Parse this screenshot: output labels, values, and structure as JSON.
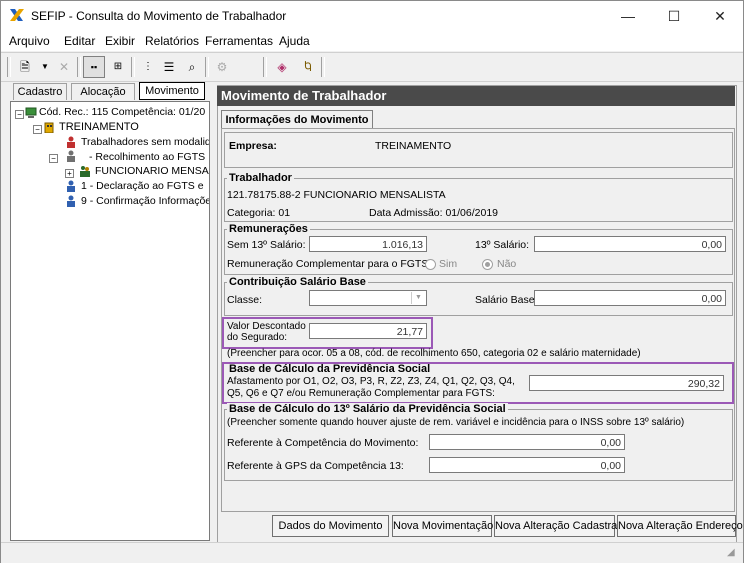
{
  "window": {
    "title": "SEFIP - Consulta do Movimento de Trabalhador",
    "minimize": "—",
    "maximize": "☐",
    "close": "✕"
  },
  "menu": [
    "Arquivo",
    "Editar",
    "Exibir",
    "Relatórios",
    "Ferramentas",
    "Ajuda"
  ],
  "tabs": {
    "cadastro": "Cadastro",
    "alocacao": "Alocação",
    "movimento": "Movimento"
  },
  "tree": {
    "root": "Cód. Rec.: 115 Competência: 01/20",
    "company": "TREINAMENTO",
    "items": [
      "Trabalhadores sem modalid",
      "- Recolhimento ao FGTS",
      "FUNCIONARIO MENSA",
      "1 - Declaração ao FGTS e",
      "9 - Confirmação Informaçõe"
    ]
  },
  "panel": {
    "header": "Movimento de Trabalhador",
    "tab": "Informações do Movimento",
    "empresa_label": "Empresa:",
    "empresa_value": "TREINAMENTO",
    "trabalhador_title": "Trabalhador",
    "trabalhador_line": "121.78175.88-2 FUNCIONARIO MENSALISTA",
    "categoria": "Categoria: 01",
    "admissao": "Data Admissão: 01/06/2019",
    "remuneracoes_title": "Remunerações",
    "sem13_label": "Sem 13º Salário:",
    "sem13_value": "1.016,13",
    "sal13_label": "13º Salário:",
    "sal13_value": "0,00",
    "rem_comp_label": "Remuneração Complementar para o FGTS:",
    "sim": "Sim",
    "nao": "Não",
    "contrib_title": "Contribuição Salário Base",
    "classe_label": "Classe:",
    "salbase_label": "Salário Base:",
    "salbase_value": "0,00",
    "valor_desc_label1": "Valor Descontado",
    "valor_desc_label2": "do Segurado:",
    "valor_desc_value": "21,77",
    "preencher_ocor": "(Preencher para ocor. 05 a 08, cód. de recolhimento 650, categoria 02 e salário maternidade)",
    "base_title": "Base de Cálculo da Previdência Social",
    "base_line1": "Afastamento por O1, O2, O3, P3, R, Z2, Z3, Z4, Q1, Q2, Q3, Q4,",
    "base_line2": "Q5, Q6 e Q7  e/ou Remuneração Complementar para FGTS:",
    "base_value": "290,32",
    "base13_title": "Base de Cálculo do 13º Salário da Previdência Social",
    "base13_note": "(Preencher somente quando houver ajuste de rem. variável e incidência para o INSS sobre 13º salário)",
    "ref_comp_label": "Referente à Competência do Movimento:",
    "ref_comp_value": "0,00",
    "ref_gps_label": "Referente à GPS da Competência 13:",
    "ref_gps_value": "0,00"
  },
  "buttons": {
    "dados": "Dados do Movimento",
    "nova_mov": "Nova Movimentação",
    "nova_alt_cad": "Nova Alteração Cadastral",
    "nova_alt_end": "Nova Alteração Endereço"
  },
  "colors": {
    "highlight": "#9b59b6",
    "header_bg": "#4a4a4a"
  }
}
